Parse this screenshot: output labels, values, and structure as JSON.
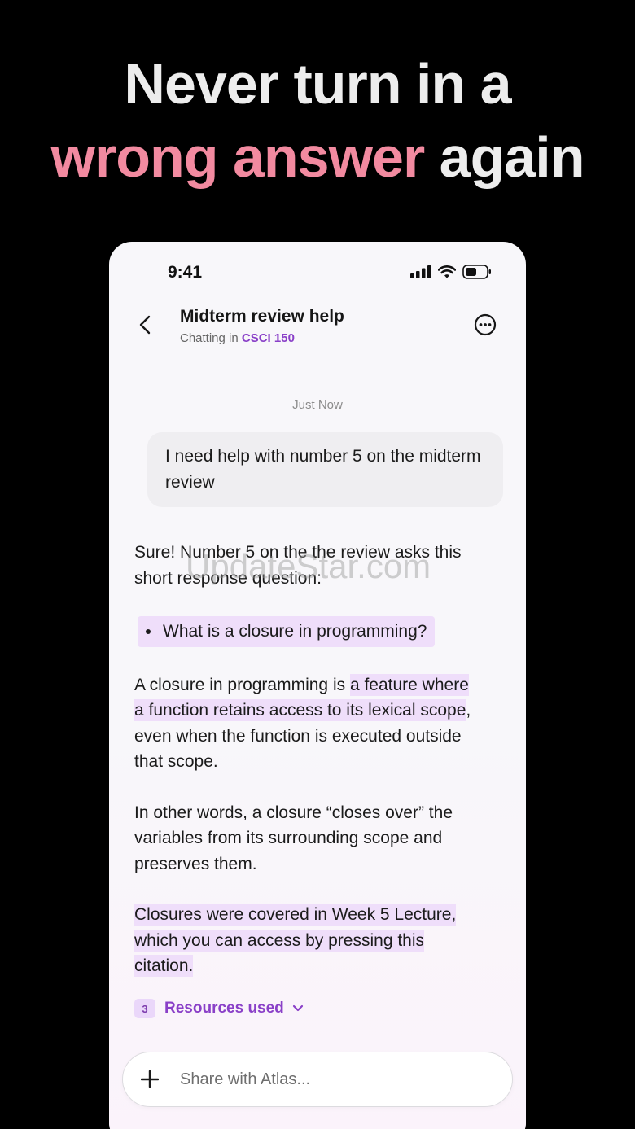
{
  "headline": {
    "line1": "Never turn in a",
    "line2_highlight": "wrong answer",
    "line2_rest": " again"
  },
  "status_bar": {
    "time": "9:41"
  },
  "header": {
    "title": "Midterm review help",
    "subtitle_prefix": "Chatting in ",
    "course": "CSCI 150"
  },
  "chat": {
    "timestamp": "Just Now",
    "user_message": "I need help with number 5 on the midterm review",
    "reply": {
      "intro": "Sure! Number 5 on the the review asks this short response question:",
      "bullet": "What is a closure in programming?",
      "para1_start": "A closure in programming is ",
      "para1_highlight": "a feature where a function retains access to its lexical scope",
      "para1_end": ", even when the function is executed outside that scope.",
      "para2": "In other words, a closure “closes over” the variables from its surrounding scope and preserves them.",
      "citation": "Closures were covered in Week 5 Lecture, which you can access by pressing this citation."
    },
    "resources": {
      "count": "3",
      "label": "Resources used"
    }
  },
  "composer": {
    "placeholder": "Share with Atlas..."
  },
  "watermark": "UpdateStar.com",
  "colors": {
    "accent": "#8a40c8",
    "highlight": "#efdefa",
    "headline_pink": "#f28aa0"
  }
}
